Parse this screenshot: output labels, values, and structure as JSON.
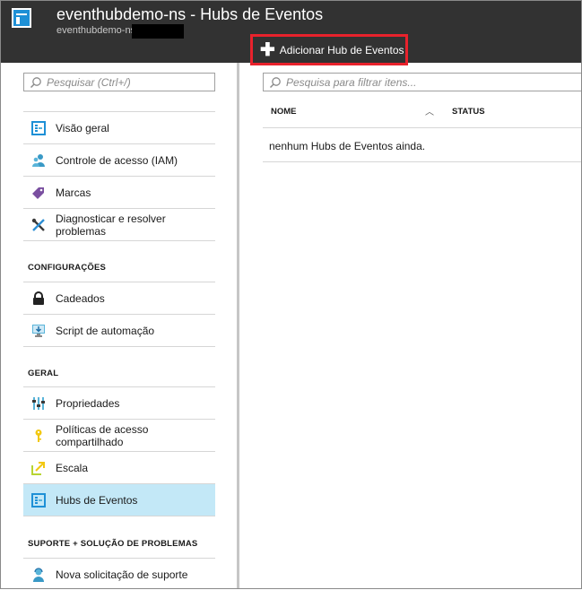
{
  "header": {
    "title": "eventhubdemo-ns - Hubs de Eventos",
    "subtitle": "eventhubdemo-ns",
    "command": {
      "label": "Adicionar Hub de Eventos",
      "icon": "plus-icon"
    },
    "colors": {
      "background": "#323232",
      "highlight_border": "#e8222c"
    }
  },
  "sidebar": {
    "search_placeholder": "Pesquisar (Ctrl+/)",
    "items_top": [
      {
        "label": "Visão geral",
        "icon": "event-hub-icon"
      },
      {
        "label": "Controle de acesso (IAM)",
        "icon": "users-icon"
      },
      {
        "label": "Marcas",
        "icon": "tag-icon"
      },
      {
        "label": "Diagnosticar e resolver problemas",
        "icon": "wrench-icon"
      }
    ],
    "section_config": "CONFIGURAÇÕES",
    "items_config": [
      {
        "label": "Cadeados",
        "icon": "lock-icon"
      },
      {
        "label": "Script de automação",
        "icon": "monitor-download-icon"
      }
    ],
    "section_geral": "GERAL",
    "items_geral": [
      {
        "label": "Propriedades",
        "icon": "properties-icon"
      },
      {
        "label": "Políticas de acesso compartilhado",
        "icon": "key-icon"
      },
      {
        "label": "Escala",
        "icon": "scale-icon"
      },
      {
        "label": "Hubs de Eventos",
        "icon": "event-hub-icon",
        "active": true
      }
    ],
    "section_suporte": "SUPORTE + SOLUÇÃO DE PROBLEMAS",
    "items_suporte": [
      {
        "label": "Nova solicitação de suporte",
        "icon": "support-person-icon"
      }
    ],
    "active_color": "#c3e8f7"
  },
  "main": {
    "filter_placeholder": "Pesquisa para filtrar itens...",
    "columns": [
      "NOME",
      "STATUS"
    ],
    "empty_message": "nenhum Hubs de Eventos ainda."
  }
}
